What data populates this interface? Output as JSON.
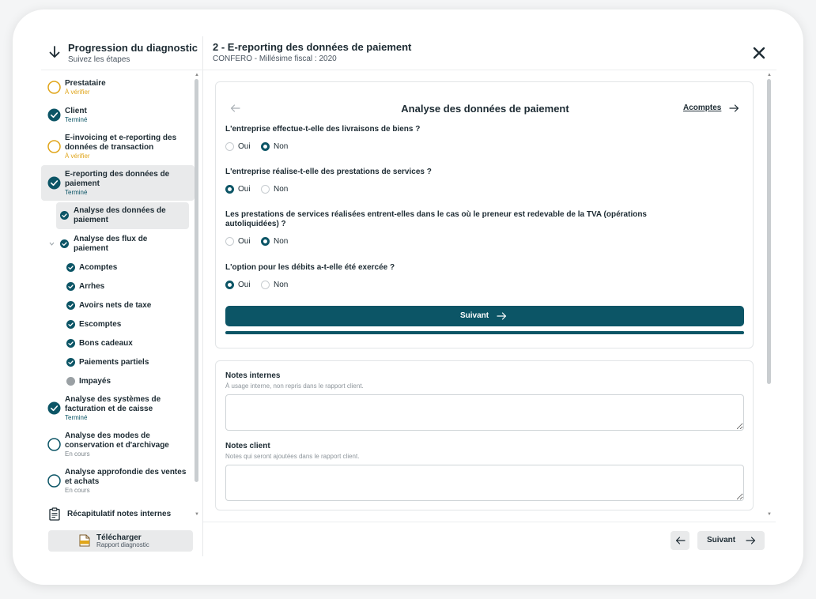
{
  "sidebar_header": {
    "title": "Progression du diagnostic",
    "subtitle": "Suivez les étapes"
  },
  "page_header": {
    "title": "2 - E-reporting des données de paiement",
    "subtitle": "CONFERO - Millésime fiscal : 2020"
  },
  "steps": [
    {
      "label": "Prestataire",
      "status": "À vérifier",
      "state": "verify"
    },
    {
      "label": "Client",
      "status": "Terminé",
      "state": "done"
    },
    {
      "label": "E-invoicing et e-reporting des données de transaction",
      "status": "À vérifier",
      "state": "verify"
    },
    {
      "label": "E-reporting des données de paiement",
      "status": "Terminé",
      "state": "done"
    },
    {
      "label": "Analyse des systèmes de facturation et de caisse",
      "status": "Terminé",
      "state": "done"
    },
    {
      "label": "Analyse des modes de conservation et d'archivage",
      "status": "En cours",
      "state": "progress"
    },
    {
      "label": "Analyse approfondie des ventes et achats",
      "status": "En cours",
      "state": "progress"
    }
  ],
  "substeps": [
    {
      "label": "Analyse des données de paiement"
    },
    {
      "label": "Analyse des flux de paiement"
    }
  ],
  "flux_items": [
    {
      "label": "Acomptes",
      "state": "done"
    },
    {
      "label": "Arrhes",
      "state": "done"
    },
    {
      "label": "Avoirs nets de taxe",
      "state": "done"
    },
    {
      "label": "Escomptes",
      "state": "done"
    },
    {
      "label": "Bons cadeaux",
      "state": "done"
    },
    {
      "label": "Paiements partiels",
      "state": "done"
    },
    {
      "label": "Impayés",
      "state": "todo"
    }
  ],
  "recap_label": "Récapitulatif notes internes",
  "download": {
    "label": "Télécharger",
    "sublabel": "Rapport diagnostic"
  },
  "card": {
    "title": "Analyse des données de paiement",
    "next_link": "Acomptes",
    "submit_label": "Suivant",
    "progress_fraction": 1.0
  },
  "questions": [
    {
      "text": "L'entreprise effectue-t-elle des livraisons de biens ?",
      "options": [
        "Oui",
        "Non"
      ],
      "selected": "Non"
    },
    {
      "text": "L'entreprise réalise-t-elle des prestations de services ?",
      "options": [
        "Oui",
        "Non"
      ],
      "selected": "Oui"
    },
    {
      "text": "Les prestations de services réalisées entrent-elles dans le cas où le preneur est redevable de la TVA (opérations autoliquidées) ?",
      "options": [
        "Oui",
        "Non"
      ],
      "selected": "Non"
    },
    {
      "text": "L'option pour les débits a-t-elle été exercée ?",
      "options": [
        "Oui",
        "Non"
      ],
      "selected": "Oui"
    }
  ],
  "notes": {
    "internal_label": "Notes internes",
    "internal_hint": "À usage interne, non repris dans le rapport client.",
    "client_label": "Notes client",
    "client_hint": "Notes qui seront ajoutées dans le rapport client."
  },
  "footer": {
    "next_label": "Suivant"
  },
  "colors": {
    "accent": "#0c5566",
    "warning": "#e0a51a",
    "muted": "#7d868c"
  }
}
